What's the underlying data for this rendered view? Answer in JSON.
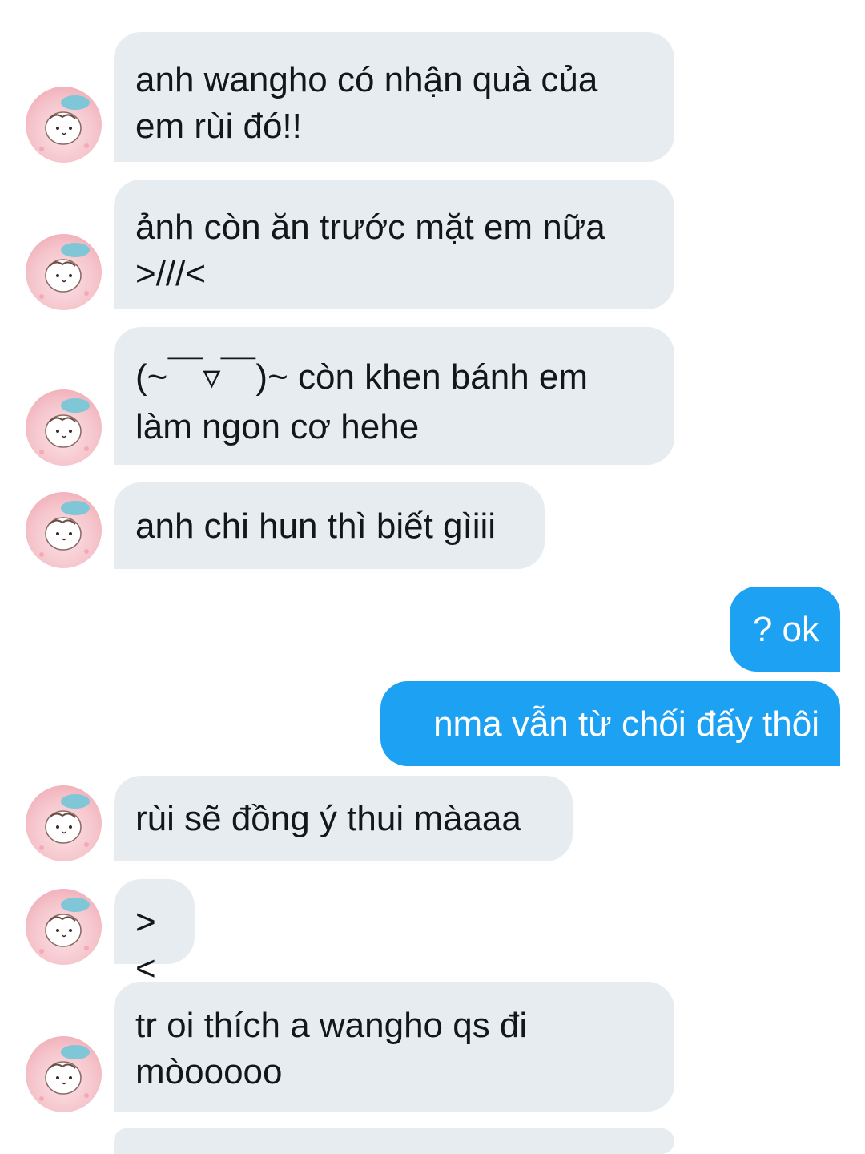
{
  "conversation": {
    "messages": [
      {
        "sender": "them",
        "text": "anh wangho có nhận quà của\nem rùi đó!!"
      },
      {
        "sender": "them",
        "text": "ảnh còn ăn trước mặt em nữa\n>///<"
      },
      {
        "sender": "them",
        "text": "(~￣▿￣)~ còn khen bánh em\nlàm ngon cơ hehe"
      },
      {
        "sender": "them",
        "text": "anh chi hun thì biết gìiii"
      },
      {
        "sender": "me",
        "text": "? ok"
      },
      {
        "sender": "me",
        "text": "nma vẫn từ chối đấy thôi"
      },
      {
        "sender": "them",
        "text": "rùi sẽ đồng ý thui màaaa"
      },
      {
        "sender": "them",
        "text": "><"
      },
      {
        "sender": "them",
        "text": "tr oi thích a wangho qs đi\nmòooooo"
      }
    ]
  },
  "colors": {
    "incoming_bubble": "#e6ecf0",
    "outgoing_bubble": "#1da1f2",
    "incoming_text": "#14171a",
    "outgoing_text": "#ffffff"
  },
  "icons": {
    "avatar": "hamster-avatar-icon"
  }
}
